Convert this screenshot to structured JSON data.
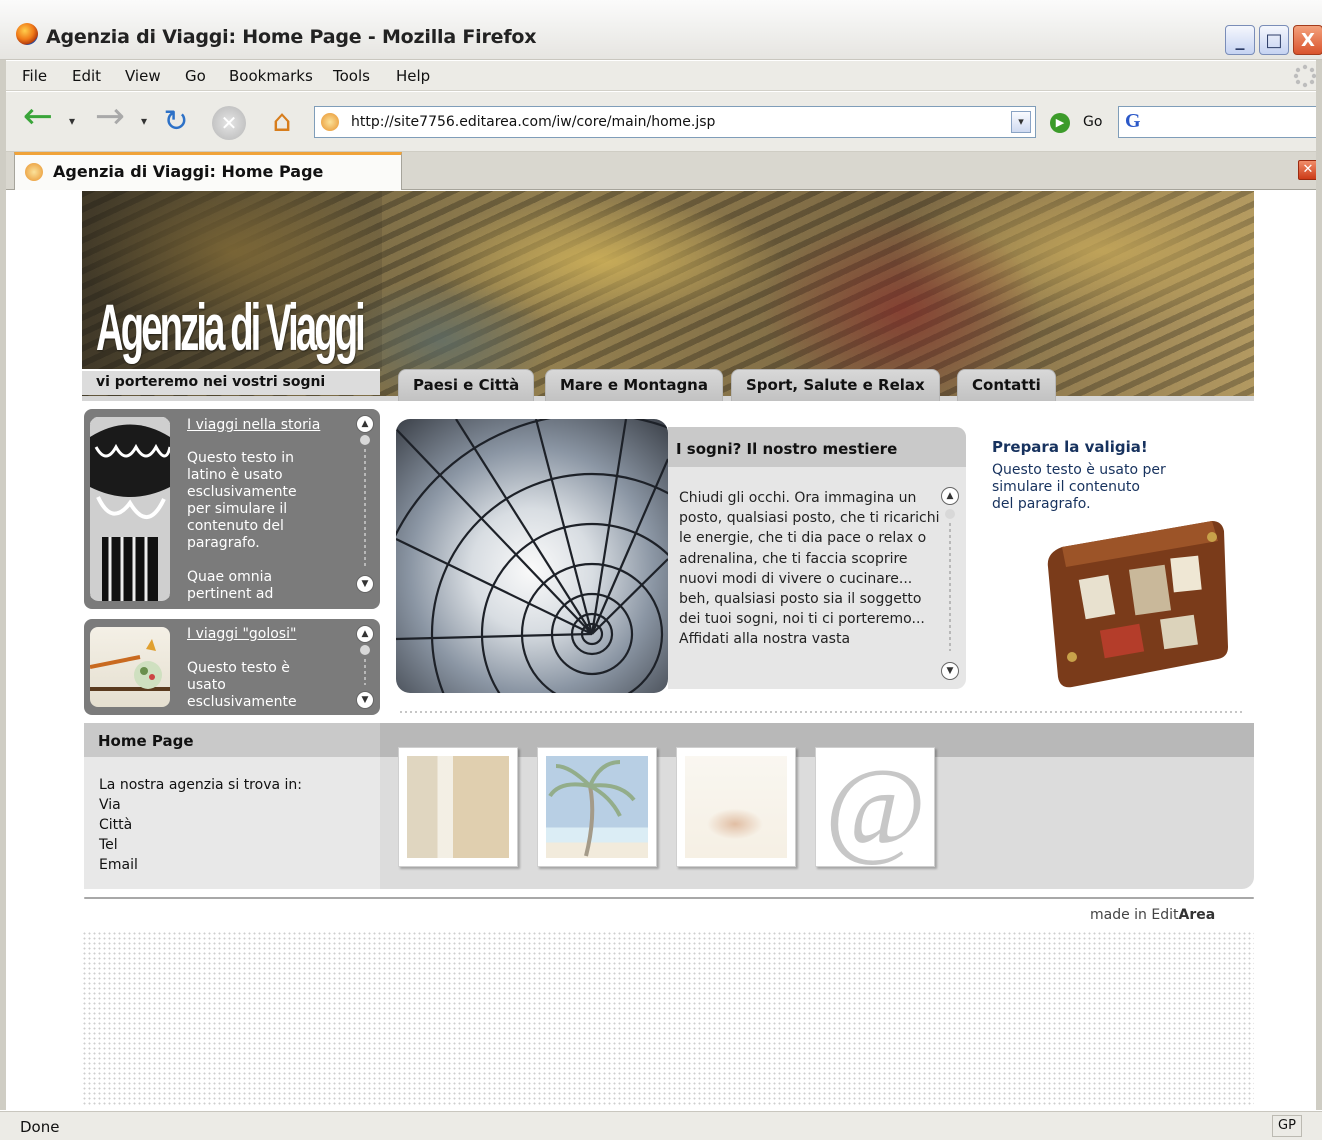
{
  "window": {
    "title": "Agenzia di Viaggi: Home Page - Mozilla Firefox",
    "minimize_glyph": "_",
    "maximize_glyph": "□",
    "close_glyph": "X"
  },
  "menubar": {
    "items": [
      "File",
      "Edit",
      "View",
      "Go",
      "Bookmarks",
      "Tools",
      "Help"
    ]
  },
  "toolbar": {
    "back_icon": "←",
    "forward_icon": "→",
    "reload_icon": "↻",
    "stop_icon": "✕",
    "home_icon": "⌂",
    "dropdown_glyph": "▾",
    "url": "http://site7756.editarea.com/iw/core/main/home.jsp",
    "go_label": "Go",
    "go_glyph": "▶",
    "search_logo": "G"
  },
  "tabs": [
    {
      "label": "Agenzia di Viaggi: Home Page",
      "active": true
    }
  ],
  "tab_close_glyph": "✕",
  "status": {
    "text": "Done",
    "badge": "GP"
  },
  "site": {
    "title": "Agenzia di Viaggi",
    "tagline": "vi porteremo nei vostri sogni",
    "nav": [
      "Paesi e Città",
      "Mare e Montagna",
      "Sport, Salute e Relax",
      "Contatti"
    ],
    "boxes": [
      {
        "title": "I viaggi nella storia",
        "text": "Questo testo in\nlatino è usato\nesclusivamente\nper simulare il\ncontenuto del\nparagrafo.\n\nQuae omnia\npertinent ad"
      },
      {
        "title": "I viaggi \"golosi\"",
        "text": "Questo testo è\nusato\nesclusivamente"
      }
    ],
    "feature": {
      "title": "I sogni? Il nostro mestiere",
      "text": "Chiudi gli occhi. Ora immagina un posto, qualsiasi posto, che ti ricarichi le energie, che ti dia pace o relax o adrenalina, che ti faccia scoprire nuovi modi di vivere o cucinare... beh, qualsiasi posto sia il soggetto dei tuoi sogni, noi ti ci porteremo... Affidati alla nostra vasta"
    },
    "promo": {
      "title": "Prepara la valigia!",
      "text": "Questo testo è usato per\nsimulare il contenuto\ndel paragrafo."
    },
    "homepage": {
      "title": "Home Page",
      "address": "La nostra agenzia si trova in:\nVia\nCittà\nTel\nEmail"
    },
    "footer": {
      "made_in": "made in Edit",
      "brand": "Area"
    },
    "scroll_up_glyph": "▲",
    "scroll_down_glyph": "▼",
    "at_glyph": "@"
  },
  "colors": {
    "header_brown": "#8b7a4d",
    "box_gray": "#7b7b7b",
    "promo_navy": "#17325e",
    "tab_accent": "#f0a33a"
  }
}
